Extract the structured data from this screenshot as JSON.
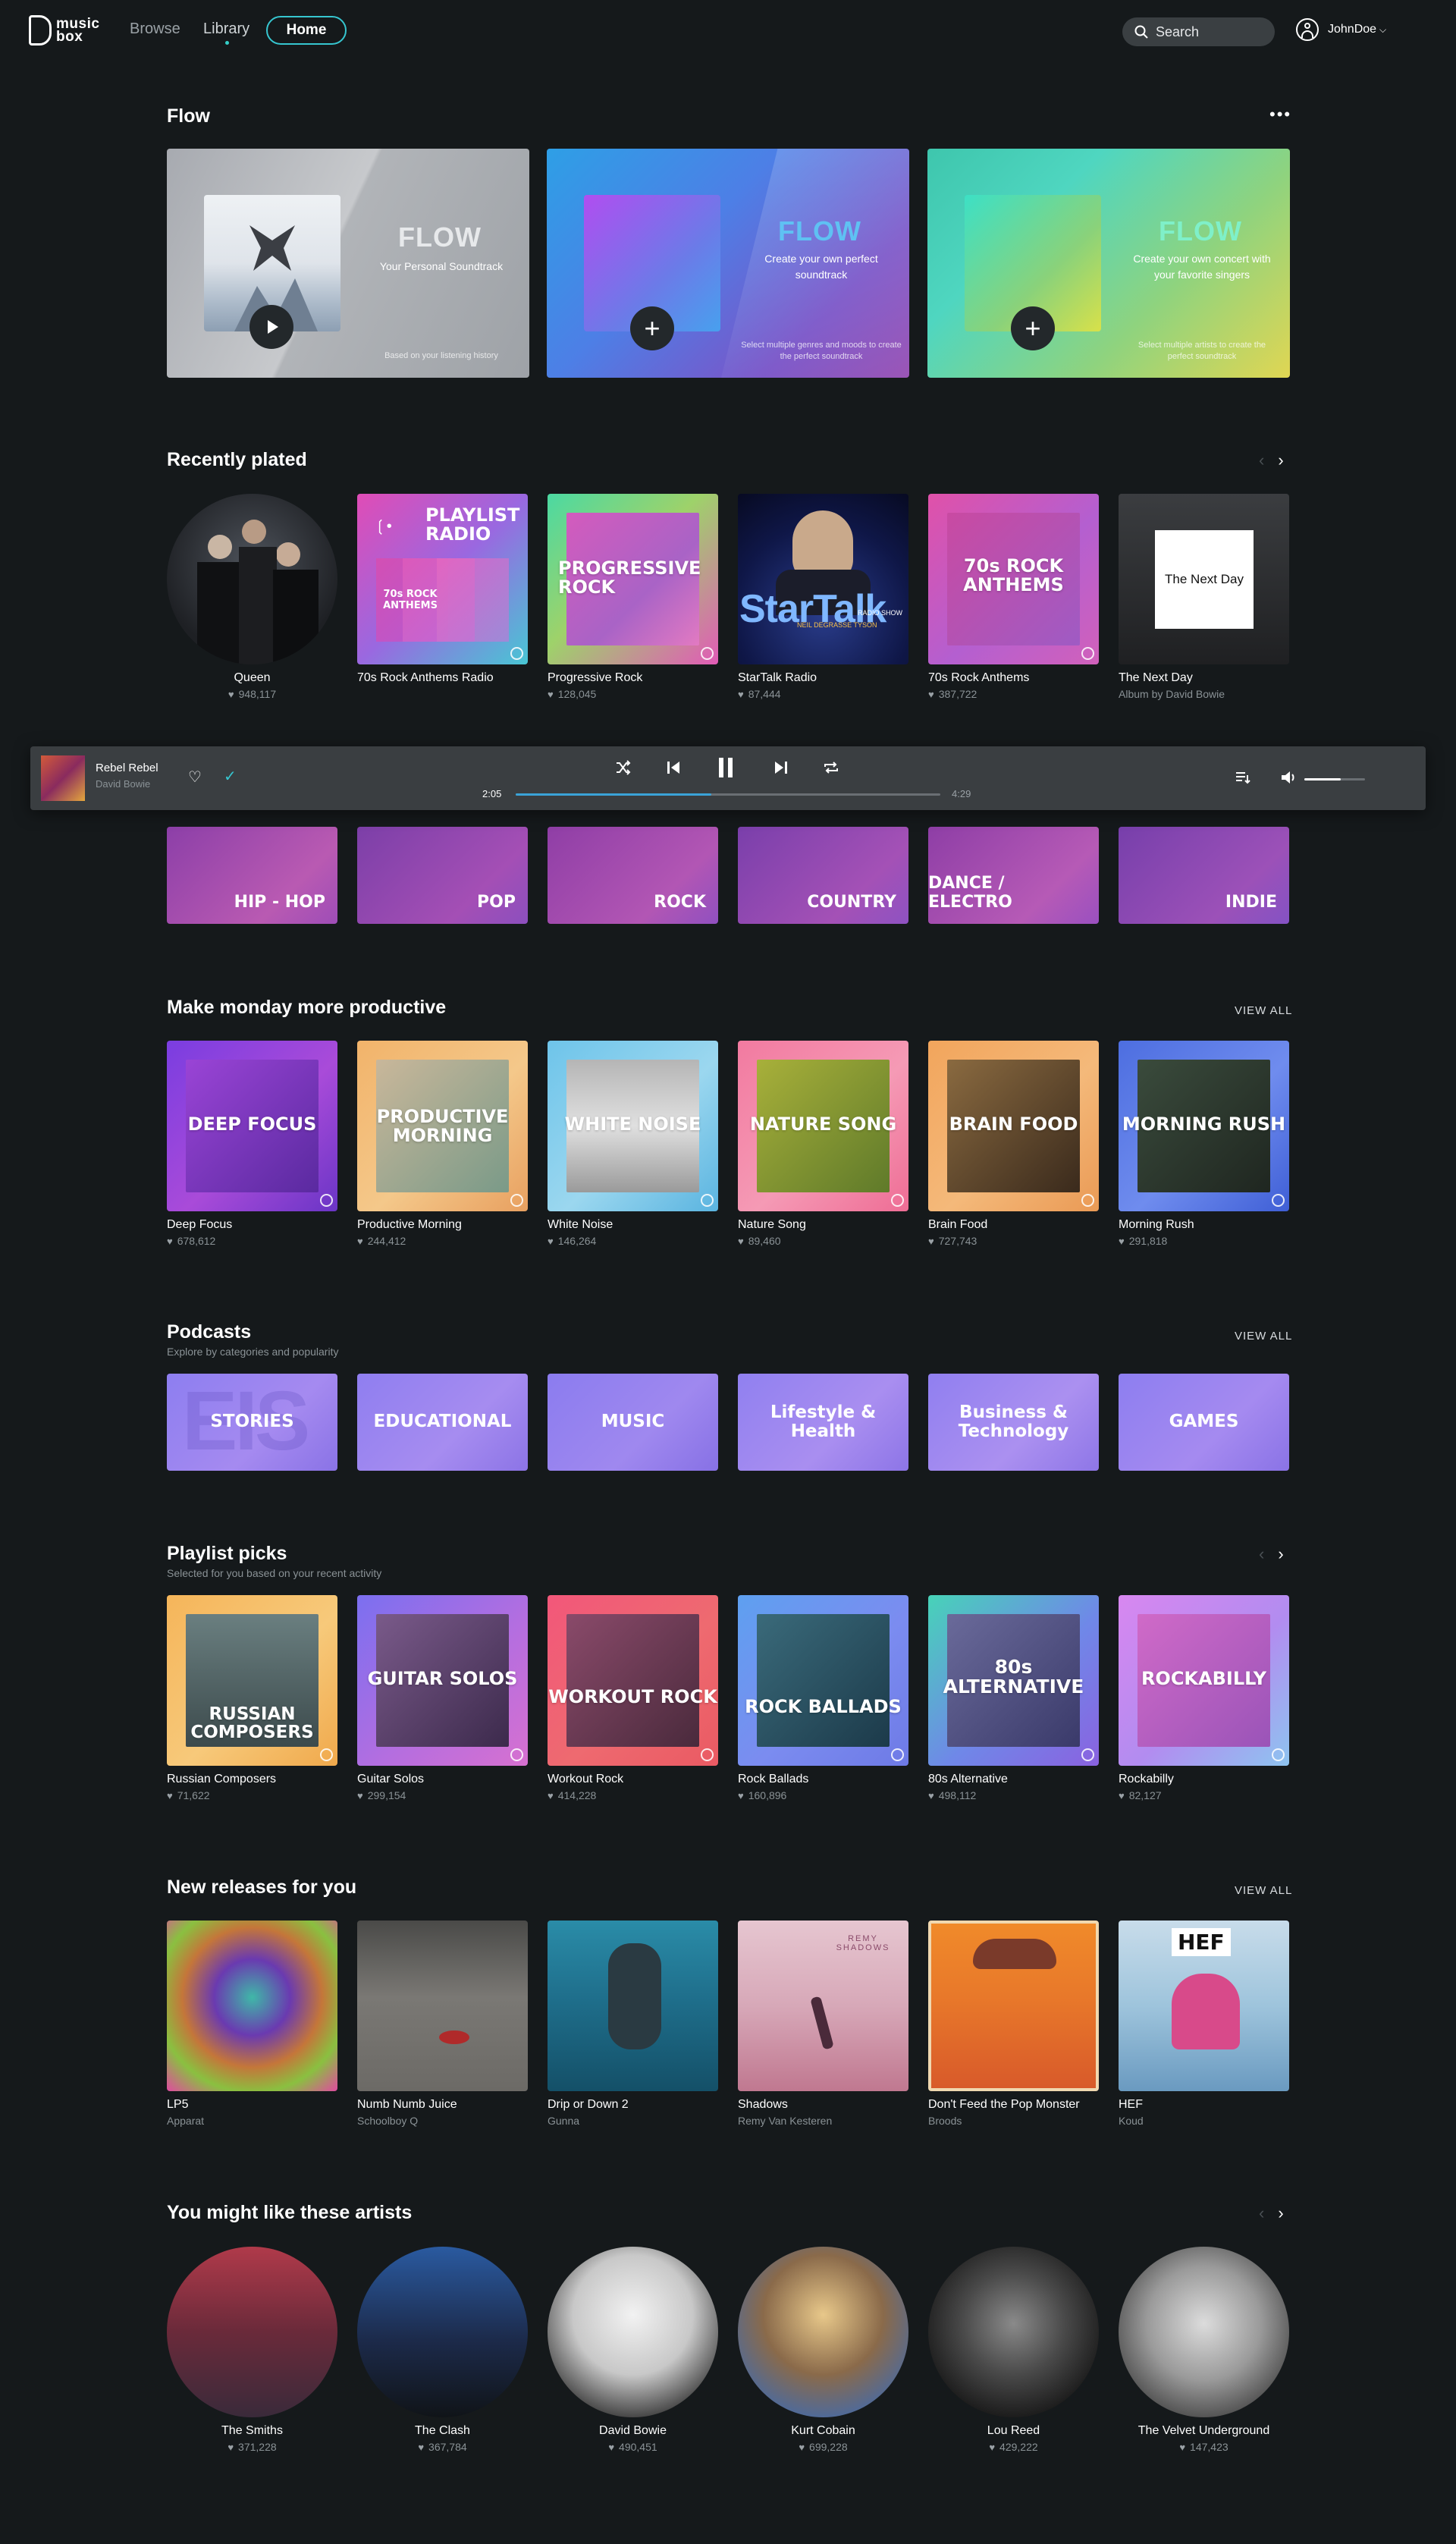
{
  "nav": {
    "logo_top": "music",
    "logo_bottom": "box",
    "browse": "Browse",
    "library": "Library",
    "home": "Home",
    "search_label": "Search",
    "user": "JohnDoe"
  },
  "flow": {
    "title": "Flow",
    "more": "•••",
    "cards": [
      {
        "title": "FLOW",
        "desc": "Your Personal Soundtrack",
        "note": "Based on your listening history"
      },
      {
        "title": "FLOW",
        "desc": "Create your own perfect soundtrack",
        "note": "Select multiple genres and moods to create the perfect soundtrack"
      },
      {
        "title": "FLOW",
        "desc": "Create your own concert with your favorite singers",
        "note": "Select multiple artists to create the perfect soundtrack"
      }
    ]
  },
  "recent": {
    "title": "Recently plated",
    "items": [
      {
        "name": "Queen",
        "fans": "948,117"
      },
      {
        "name": "70s Rock Anthems Radio",
        "fans": ""
      },
      {
        "name": "Progressive Rock",
        "fans": "128,045"
      },
      {
        "name": "StarTalk Radio",
        "fans": "87,444"
      },
      {
        "name": "70s Rock Anthems",
        "fans": "387,722"
      },
      {
        "name": "The Next Day",
        "fans": "Album by David Bowie"
      }
    ],
    "tiles": {
      "playlist_radio": "PLAYLIST RADIO",
      "radio_inner": "70s ROCK ANTHEMS",
      "prog": "PROGRESSIVE ROCK",
      "startalk": "StarTalk",
      "startalk_sub": "RADIO SHOW",
      "startalk_host": "NEIL DEGRASSE TYSON",
      "anthems": "70s ROCK ANTHEMS",
      "next_day": "The Next Day"
    }
  },
  "player": {
    "track": "Rebel Rebel",
    "artist": "David Bowie",
    "elapsed": "2:05",
    "duration": "4:29",
    "progress": 0.46,
    "volume": 0.6
  },
  "genres": [
    "HIP - HOP",
    "POP",
    "ROCK",
    "COUNTRY",
    "DANCE / ELECTRO",
    "INDIE"
  ],
  "monday": {
    "title": "Make monday more productive",
    "view_all": "VIEW ALL",
    "items": [
      {
        "label": "DEEP FOCUS",
        "name": "Deep Focus",
        "fans": "678,612"
      },
      {
        "label": "PRODUCTIVE MORNING",
        "name": "Productive Morning",
        "fans": "244,412"
      },
      {
        "label": "WHITE NOISE",
        "name": "White Noise",
        "fans": "146,264"
      },
      {
        "label": "NATURE SONG",
        "name": "Nature Song",
        "fans": "89,460"
      },
      {
        "label": "BRAIN FOOD",
        "name": "Brain Food",
        "fans": "727,743"
      },
      {
        "label": "MORNING RUSH",
        "name": "Morning Rush",
        "fans": "291,818"
      }
    ]
  },
  "podcasts": {
    "title": "Podcasts",
    "subtitle": "Explore by categories and popularity",
    "view_all": "VIEW ALL",
    "items": [
      "STORIES",
      "EDUCATIONAL",
      "MUSIC",
      "Lifestyle & Health",
      "Business & Technology",
      "GAMES"
    ],
    "stories_bg": "EIS"
  },
  "picks": {
    "title": "Playlist picks",
    "subtitle": "Selected for you based on your recent activity",
    "items": [
      {
        "label": "RUSSIAN COMPOSERS",
        "name": "Russian Composers",
        "fans": "71,622"
      },
      {
        "label": "GUITAR SOLOS",
        "name": "Guitar Solos",
        "fans": "299,154"
      },
      {
        "label": "WORKOUT ROCK",
        "name": "Workout Rock",
        "fans": "414,228"
      },
      {
        "label": "ROCK BALLADS",
        "name": "Rock Ballads",
        "fans": "160,896"
      },
      {
        "label": "80s ALTERNATIVE",
        "name": "80s Alternative",
        "fans": "498,112"
      },
      {
        "label": "ROCKABILLY",
        "name": "Rockabilly",
        "fans": "82,127"
      }
    ]
  },
  "releases": {
    "title": "New releases for you",
    "view_all": "VIEW ALL",
    "items": [
      {
        "name": "LP5",
        "artist": "Apparat"
      },
      {
        "name": "Numb Numb Juice",
        "artist": "Schoolboy Q"
      },
      {
        "name": "Drip or Down 2",
        "artist": "Gunna"
      },
      {
        "name": "Shadows",
        "artist": "Remy Van Kesteren"
      },
      {
        "name": "Don't Feed the Pop Monster",
        "artist": "Broods"
      },
      {
        "name": "HEF",
        "artist": "Koud"
      }
    ],
    "hef_label": "HEF",
    "shadows_label": "REMY SHADOWS"
  },
  "artists": {
    "title": "You might like these artists",
    "items": [
      {
        "name": "The Smiths",
        "fans": "371,228"
      },
      {
        "name": "The Clash",
        "fans": "367,784"
      },
      {
        "name": "David Bowie",
        "fans": "490,451"
      },
      {
        "name": "Kurt Cobain",
        "fans": "699,228"
      },
      {
        "name": "Lou Reed",
        "fans": "429,222"
      },
      {
        "name": "The Velvet Underground",
        "fans": "147,423"
      }
    ]
  },
  "colors": {
    "accent": "#36c6d0",
    "bg": "#15191b",
    "player_bg": "#3a3e41"
  }
}
